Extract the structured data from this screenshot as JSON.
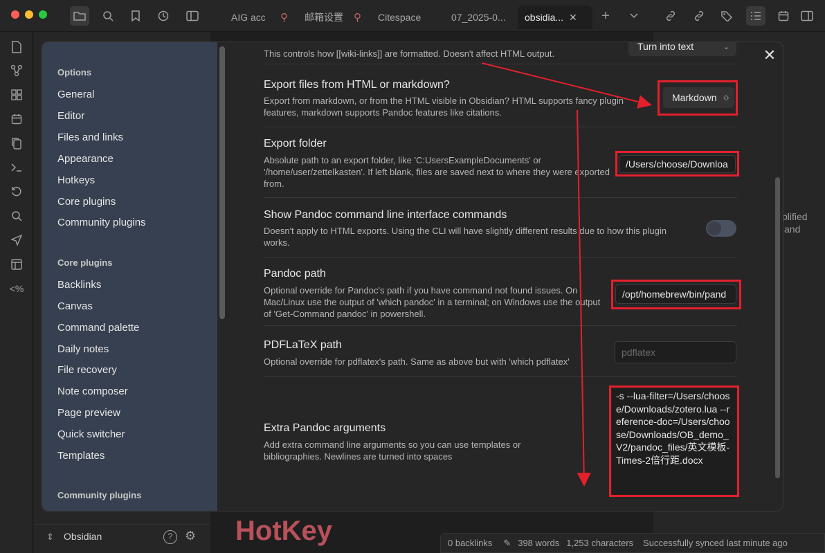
{
  "titlebar": {
    "tabs": [
      {
        "label": "AIG acc",
        "pinned": true
      },
      {
        "label": "邮箱设置",
        "pinned": true
      },
      {
        "label": "Citespace",
        "pinned": false
      },
      {
        "label": "07_2025-0...",
        "pinned": false
      },
      {
        "label": "obsidia...",
        "pinned": false,
        "active": true
      }
    ]
  },
  "vault": {
    "name": "Obsidian"
  },
  "background": {
    "hotkey_text": "HotKey",
    "right_text_1": "plified",
    "right_text_2": "and"
  },
  "statusbar": {
    "backlinks": "0 backlinks",
    "words": "398 words",
    "characters": "1,253 characters",
    "sync": "Successfully synced last minute ago"
  },
  "settings_nav": {
    "options_heading": "Options",
    "options": [
      "General",
      "Editor",
      "Files and links",
      "Appearance",
      "Hotkeys",
      "Core plugins",
      "Community plugins"
    ],
    "core_heading": "Core plugins",
    "core": [
      "Backlinks",
      "Canvas",
      "Command palette",
      "Daily notes",
      "File recovery",
      "Note composer",
      "Page preview",
      "Quick switcher",
      "Templates"
    ],
    "community_heading": "Community plugins"
  },
  "settings": {
    "wikilinks": {
      "desc": "This controls how [[wiki-links]] are formatted. Doesn't affect HTML output.",
      "value": "Turn into text"
    },
    "export_from": {
      "name": "Export files from HTML or markdown?",
      "desc": "Export from markdown, or from the HTML visible in Obsidian? HTML supports fancy plugin features, markdown supports Pandoc features like citations.",
      "value": "Markdown"
    },
    "export_folder": {
      "name": "Export folder",
      "desc": "Absolute path to an export folder, like 'C:UsersExampleDocuments' or '/home/user/zettelkasten'. If left blank, files are saved next to where they were exported from.",
      "value": "/Users/choose/Downloa"
    },
    "show_cli": {
      "name": "Show Pandoc command line interface commands",
      "desc": "Doesn't apply to HTML exports. Using the CLI will have slightly different results due to how this plugin works.",
      "enabled": false
    },
    "pandoc_path": {
      "name": "Pandoc path",
      "desc": "Optional override for Pandoc's path if you have command not found issues. On Mac/Linux use the output of 'which pandoc' in a terminal; on Windows use the output of 'Get-Command pandoc' in powershell.",
      "value": "/opt/homebrew/bin/pand"
    },
    "pdflatex_path": {
      "name": "PDFLaTeX path",
      "desc": "Optional override for pdflatex's path. Same as above but with 'which pdflatex'",
      "placeholder": "pdflatex"
    },
    "extra_args": {
      "name": "Extra Pandoc arguments",
      "desc": "Add extra command line arguments so you can use templates or bibliographies. Newlines are turned into spaces",
      "value": "-s --lua-filter=/Users/choose/Downloads/zotero.lua --reference-doc=/Users/choose/Downloads/OB_demo_V2/pandoc_files/英文模板-Times-2倍行距.docx"
    }
  },
  "colors": {
    "annotation": "#e3202c",
    "nav_bg": "#374050"
  }
}
